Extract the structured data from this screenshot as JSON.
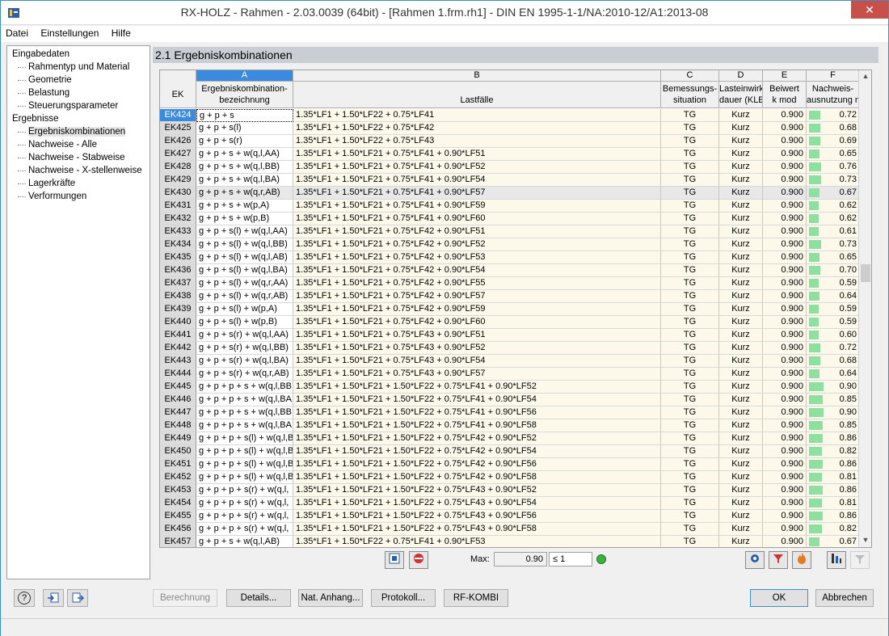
{
  "window": {
    "title": "RX-HOLZ - Rahmen - 2.03.0039 (64bit) - [Rahmen 1.frm.rh1] - DIN EN 1995-1-1/NA:2010-12/A1:2013-08",
    "close": "✕"
  },
  "menu": [
    "Datei",
    "Einstellungen",
    "Hilfe"
  ],
  "tree": {
    "input_root": "Eingabedaten",
    "input_items": [
      "Rahmentyp und Material",
      "Geometrie",
      "Belastung",
      "Steuerungsparameter"
    ],
    "results_root": "Ergebnisse",
    "results_items": [
      "Ergebniskombinationen",
      "Nachweise - Alle",
      "Nachweise - Stabweise",
      "Nachweise - X-stellenweise",
      "Lagerkräfte",
      "Verformungen"
    ]
  },
  "section_title": "2.1 Ergebniskombinationen",
  "columns": {
    "letters": [
      "A",
      "B",
      "C",
      "D",
      "E",
      "F"
    ],
    "ek": "EK",
    "a1": "Ergebniskombination-",
    "a2": "bezeichnung",
    "b": "Lastfälle",
    "c1": "Bemessungs-",
    "c2": "situation",
    "d1": "Lasteinwirk",
    "d2": "dauer (KLE",
    "e1": "Beiwert",
    "e2": "k mod",
    "f1": "Nachweis-",
    "f2": "ausnutzung η"
  },
  "rows": [
    {
      "ek": "EK424",
      "a": "g + p + s",
      "b": "1.35*LF1 + 1.50*LF22 + 0.75*LF41",
      "c": "TG",
      "d": "Kurz",
      "e": "0.900",
      "f": "0.72",
      "fv": 0.72
    },
    {
      "ek": "EK425",
      "a": "g + p + s(l)",
      "b": "1.35*LF1 + 1.50*LF22 + 0.75*LF42",
      "c": "TG",
      "d": "Kurz",
      "e": "0.900",
      "f": "0.68",
      "fv": 0.68
    },
    {
      "ek": "EK426",
      "a": "g + p + s(r)",
      "b": "1.35*LF1 + 1.50*LF22 + 0.75*LF43",
      "c": "TG",
      "d": "Kurz",
      "e": "0.900",
      "f": "0.69",
      "fv": 0.69
    },
    {
      "ek": "EK427",
      "a": "g + p + s + w(q,l,AA)",
      "b": "1.35*LF1 + 1.50*LF21 + 0.75*LF41 + 0.90*LF51",
      "c": "TG",
      "d": "Kurz",
      "e": "0.900",
      "f": "0.65",
      "fv": 0.65
    },
    {
      "ek": "EK428",
      "a": "g + p + s + w(q,l,BB)",
      "b": "1.35*LF1 + 1.50*LF21 + 0.75*LF41 + 0.90*LF52",
      "c": "TG",
      "d": "Kurz",
      "e": "0.900",
      "f": "0.76",
      "fv": 0.76
    },
    {
      "ek": "EK429",
      "a": "g + p + s + w(q,l,BA)",
      "b": "1.35*LF1 + 1.50*LF21 + 0.75*LF41 + 0.90*LF54",
      "c": "TG",
      "d": "Kurz",
      "e": "0.900",
      "f": "0.73",
      "fv": 0.73
    },
    {
      "ek": "EK430",
      "a": "g + p + s + w(q,r,AB)",
      "b": "1.35*LF1 + 1.50*LF21 + 0.75*LF41 + 0.90*LF57",
      "c": "TG",
      "d": "Kurz",
      "e": "0.900",
      "f": "0.67",
      "fv": 0.67
    },
    {
      "ek": "EK431",
      "a": "g + p + s + w(p,A)",
      "b": "1.35*LF1 + 1.50*LF21 + 0.75*LF41 + 0.90*LF59",
      "c": "TG",
      "d": "Kurz",
      "e": "0.900",
      "f": "0.62",
      "fv": 0.62
    },
    {
      "ek": "EK432",
      "a": "g + p + s + w(p,B)",
      "b": "1.35*LF1 + 1.50*LF21 + 0.75*LF41 + 0.90*LF60",
      "c": "TG",
      "d": "Kurz",
      "e": "0.900",
      "f": "0.62",
      "fv": 0.62
    },
    {
      "ek": "EK433",
      "a": "g + p + s(l) + w(q,l,AA)",
      "b": "1.35*LF1 + 1.50*LF21 + 0.75*LF42 + 0.90*LF51",
      "c": "TG",
      "d": "Kurz",
      "e": "0.900",
      "f": "0.61",
      "fv": 0.61
    },
    {
      "ek": "EK434",
      "a": "g + p + s(l) + w(q,l,BB)",
      "b": "1.35*LF1 + 1.50*LF21 + 0.75*LF42 + 0.90*LF52",
      "c": "TG",
      "d": "Kurz",
      "e": "0.900",
      "f": "0.73",
      "fv": 0.73
    },
    {
      "ek": "EK435",
      "a": "g + p + s(l) + w(q,l,AB)",
      "b": "1.35*LF1 + 1.50*LF21 + 0.75*LF42 + 0.90*LF53",
      "c": "TG",
      "d": "Kurz",
      "e": "0.900",
      "f": "0.65",
      "fv": 0.65
    },
    {
      "ek": "EK436",
      "a": "g + p + s(l) + w(q,l,BA)",
      "b": "1.35*LF1 + 1.50*LF21 + 0.75*LF42 + 0.90*LF54",
      "c": "TG",
      "d": "Kurz",
      "e": "0.900",
      "f": "0.70",
      "fv": 0.7
    },
    {
      "ek": "EK437",
      "a": "g + p + s(l) + w(q,r,AA)",
      "b": "1.35*LF1 + 1.50*LF21 + 0.75*LF42 + 0.90*LF55",
      "c": "TG",
      "d": "Kurz",
      "e": "0.900",
      "f": "0.59",
      "fv": 0.59
    },
    {
      "ek": "EK438",
      "a": "g + p + s(l) + w(q,r,AB)",
      "b": "1.35*LF1 + 1.50*LF21 + 0.75*LF42 + 0.90*LF57",
      "c": "TG",
      "d": "Kurz",
      "e": "0.900",
      "f": "0.64",
      "fv": 0.64
    },
    {
      "ek": "EK439",
      "a": "g + p + s(l) + w(p,A)",
      "b": "1.35*LF1 + 1.50*LF21 + 0.75*LF42 + 0.90*LF59",
      "c": "TG",
      "d": "Kurz",
      "e": "0.900",
      "f": "0.59",
      "fv": 0.59
    },
    {
      "ek": "EK440",
      "a": "g + p + s(l) + w(p,B)",
      "b": "1.35*LF1 + 1.50*LF21 + 0.75*LF42 + 0.90*LF60",
      "c": "TG",
      "d": "Kurz",
      "e": "0.900",
      "f": "0.59",
      "fv": 0.59
    },
    {
      "ek": "EK441",
      "a": "g + p + s(r) + w(q,l,AA)",
      "b": "1.35*LF1 + 1.50*LF21 + 0.75*LF43 + 0.90*LF51",
      "c": "TG",
      "d": "Kurz",
      "e": "0.900",
      "f": "0.60",
      "fv": 0.6
    },
    {
      "ek": "EK442",
      "a": "g + p + s(r) + w(q,l,BB)",
      "b": "1.35*LF1 + 1.50*LF21 + 0.75*LF43 + 0.90*LF52",
      "c": "TG",
      "d": "Kurz",
      "e": "0.900",
      "f": "0.72",
      "fv": 0.72
    },
    {
      "ek": "EK443",
      "a": "g + p + s(r) + w(q,l,BA)",
      "b": "1.35*LF1 + 1.50*LF21 + 0.75*LF43 + 0.90*LF54",
      "c": "TG",
      "d": "Kurz",
      "e": "0.900",
      "f": "0.68",
      "fv": 0.68
    },
    {
      "ek": "EK444",
      "a": "g + p + s(r) + w(q,r,AB)",
      "b": "1.35*LF1 + 1.50*LF21 + 0.75*LF43 + 0.90*LF57",
      "c": "TG",
      "d": "Kurz",
      "e": "0.900",
      "f": "0.64",
      "fv": 0.64
    },
    {
      "ek": "EK445",
      "a": "g + p + p + s + w(q,l,BB",
      "b": "1.35*LF1 + 1.50*LF21 + 1.50*LF22 + 0.75*LF41 + 0.90*LF52",
      "c": "TG",
      "d": "Kurz",
      "e": "0.900",
      "f": "0.90",
      "fv": 0.9
    },
    {
      "ek": "EK446",
      "a": "g + p + p + s + w(q,l,BA",
      "b": "1.35*LF1 + 1.50*LF21 + 1.50*LF22 + 0.75*LF41 + 0.90*LF54",
      "c": "TG",
      "d": "Kurz",
      "e": "0.900",
      "f": "0.85",
      "fv": 0.85
    },
    {
      "ek": "EK447",
      "a": "g + p + p + s + w(q,l,BB",
      "b": "1.35*LF1 + 1.50*LF21 + 1.50*LF22 + 0.75*LF41 + 0.90*LF56",
      "c": "TG",
      "d": "Kurz",
      "e": "0.900",
      "f": "0.90",
      "fv": 0.9
    },
    {
      "ek": "EK448",
      "a": "g + p + p + s + w(q,l,BA",
      "b": "1.35*LF1 + 1.50*LF21 + 1.50*LF22 + 0.75*LF41 + 0.90*LF58",
      "c": "TG",
      "d": "Kurz",
      "e": "0.900",
      "f": "0.85",
      "fv": 0.85
    },
    {
      "ek": "EK449",
      "a": "g + p + p + s(l) + w(q,l,B",
      "b": "1.35*LF1 + 1.50*LF21 + 1.50*LF22 + 0.75*LF42 + 0.90*LF52",
      "c": "TG",
      "d": "Kurz",
      "e": "0.900",
      "f": "0.86",
      "fv": 0.86
    },
    {
      "ek": "EK450",
      "a": "g + p + p + s(l) + w(q,l,B",
      "b": "1.35*LF1 + 1.50*LF21 + 1.50*LF22 + 0.75*LF42 + 0.90*LF54",
      "c": "TG",
      "d": "Kurz",
      "e": "0.900",
      "f": "0.82",
      "fv": 0.82
    },
    {
      "ek": "EK451",
      "a": "g + p + p + s(l) + w(q,l,B",
      "b": "1.35*LF1 + 1.50*LF21 + 1.50*LF22 + 0.75*LF42 + 0.90*LF56",
      "c": "TG",
      "d": "Kurz",
      "e": "0.900",
      "f": "0.86",
      "fv": 0.86
    },
    {
      "ek": "EK452",
      "a": "g + p + p + s(l) + w(q,l,B",
      "b": "1.35*LF1 + 1.50*LF21 + 1.50*LF22 + 0.75*LF42 + 0.90*LF58",
      "c": "TG",
      "d": "Kurz",
      "e": "0.900",
      "f": "0.81",
      "fv": 0.81
    },
    {
      "ek": "EK453",
      "a": "g + p + p + s(r) + w(q,l,",
      "b": "1.35*LF1 + 1.50*LF21 + 1.50*LF22 + 0.75*LF43 + 0.90*LF52",
      "c": "TG",
      "d": "Kurz",
      "e": "0.900",
      "f": "0.86",
      "fv": 0.86
    },
    {
      "ek": "EK454",
      "a": "g + p + p + s(r) + w(q,l,",
      "b": "1.35*LF1 + 1.50*LF21 + 1.50*LF22 + 0.75*LF43 + 0.90*LF54",
      "c": "TG",
      "d": "Kurz",
      "e": "0.900",
      "f": "0.81",
      "fv": 0.81
    },
    {
      "ek": "EK455",
      "a": "g + p + p + s(r) + w(q,l,",
      "b": "1.35*LF1 + 1.50*LF21 + 1.50*LF22 + 0.75*LF43 + 0.90*LF56",
      "c": "TG",
      "d": "Kurz",
      "e": "0.900",
      "f": "0.86",
      "fv": 0.86
    },
    {
      "ek": "EK456",
      "a": "g + p + p + s(r) + w(q,l,",
      "b": "1.35*LF1 + 1.50*LF21 + 1.50*LF22 + 0.75*LF43 + 0.90*LF58",
      "c": "TG",
      "d": "Kurz",
      "e": "0.900",
      "f": "0.82",
      "fv": 0.82
    },
    {
      "ek": "EK457",
      "a": "g + p + s + w(q,l,AB)",
      "b": "1.35*LF1 + 1.50*LF22 + 0.75*LF41 + 0.90*LF53",
      "c": "TG",
      "d": "Kurz",
      "e": "0.900",
      "f": "0.67",
      "fv": 0.67
    }
  ],
  "footer": {
    "max_label": "Max:",
    "max_value": "0.90",
    "le_value": "≤ 1"
  },
  "buttons": {
    "berechnung": "Berechnung",
    "details": "Details...",
    "nat_anhang": "Nat. Anhang...",
    "protokoll": "Protokoll...",
    "rfkombi": "RF-KOMBI",
    "ok": "OK",
    "abbrechen": "Abbrechen"
  },
  "icons": {
    "help": "?",
    "scroll_up": "▲",
    "scroll_down": "▼"
  },
  "colors": {
    "accent": "#3a8be0",
    "bar": "#8de0a0",
    "ok_indicator": "#3cb043"
  }
}
